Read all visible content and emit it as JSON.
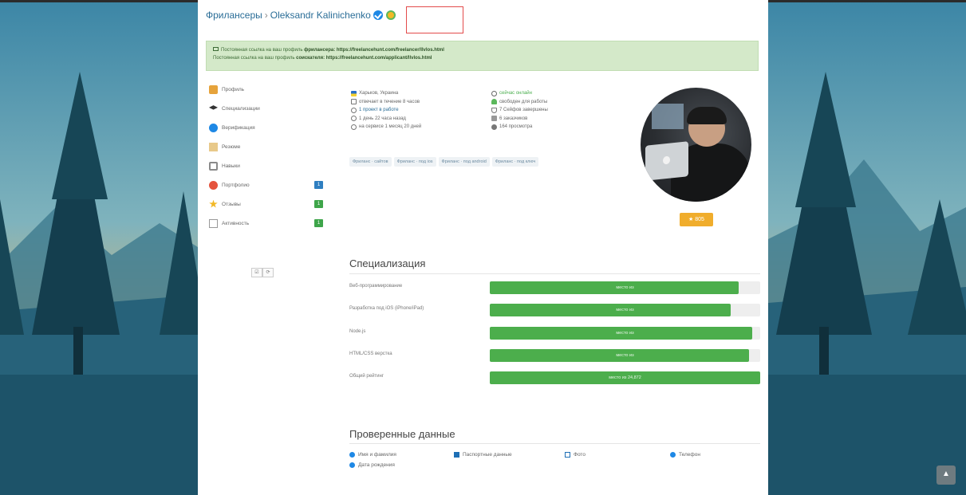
{
  "breadcrumb": {
    "parent": "Фрилансеры",
    "separator": "›",
    "name": "Oleksandr Kalinichenko"
  },
  "alert": {
    "line1_prefix": "Постоянная ссылка на ваш профиль",
    "line1_bold": "фрилансера: https://freelancehunt.com/freelancer/llvlos.html",
    "line2_prefix": "Постоянная ссылка на ваш профиль",
    "line2_bold": "соискателя: https://freelancehunt.com/applicant/llvlos.html"
  },
  "menu": {
    "items": [
      {
        "label": "Профиль",
        "icon": "user-icon",
        "count": ""
      },
      {
        "label": "Специализации",
        "icon": "graduation-cap-icon",
        "count": ""
      },
      {
        "label": "Верификация",
        "icon": "check-circle-icon",
        "count": ""
      },
      {
        "label": "Резюме",
        "icon": "resume-icon",
        "count": ""
      },
      {
        "label": "Навыки",
        "icon": "tools-icon",
        "count": ""
      },
      {
        "label": "Портфолио",
        "icon": "portfolio-icon",
        "count": "1"
      },
      {
        "label": "Отзывы",
        "icon": "star-icon",
        "count": "1"
      },
      {
        "label": "Активность",
        "icon": "activity-icon",
        "count": "1"
      }
    ],
    "actions": [
      "☑",
      "⟳"
    ]
  },
  "info": {
    "location": "Харьков, Украина",
    "response": "отвечает в течение 8 часов",
    "projects": "1 проект в работе",
    "last_seen": "1 день 22 часа назад",
    "on_service": "на сервисе 1 месяц 20 дней",
    "online": "сейчас онлайн",
    "available": "свободен для работы",
    "completed": "7 Сейфов завершены",
    "clients": "6 заказчиков",
    "views": "164 просмотра"
  },
  "tags": [
    "Фриланс · сайтов",
    "Фриланс · под ios",
    "Фриланс · под android",
    "Фриланс · под ключ"
  ],
  "rating": "★ 805",
  "specialization": {
    "title": "Специализация",
    "rows": [
      {
        "label": "Веб-программирование",
        "text": "место из",
        "fill": 0.92
      },
      {
        "label": "Разработка под iOS (iPhone/iPad)",
        "text": "место из",
        "fill": 0.89
      },
      {
        "label": "Node.js",
        "text": "место из",
        "fill": 0.97
      },
      {
        "label": "HTML/CSS верстка",
        "text": "место из",
        "fill": 0.96
      },
      {
        "label": "Общий рейтинг",
        "text": "место из 24,872",
        "fill": 1.0
      }
    ]
  },
  "verified": {
    "title": "Проверенные данные",
    "items": [
      {
        "label": "Имя и фамилия",
        "icon": "check-circle-icon"
      },
      {
        "label": "Дата рождения",
        "icon": "check-circle-icon"
      },
      {
        "label": "Паспортные данные",
        "icon": "passport-icon"
      },
      {
        "label": "Фото",
        "icon": "photo-icon"
      },
      {
        "label": "Телефон",
        "icon": "check-circle-icon"
      }
    ]
  },
  "scroll_top": "▲"
}
